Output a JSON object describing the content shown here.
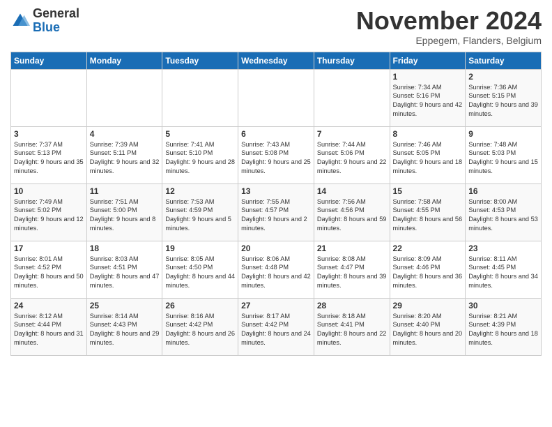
{
  "logo": {
    "general": "General",
    "blue": "Blue"
  },
  "title": "November 2024",
  "subtitle": "Eppegem, Flanders, Belgium",
  "weekdays": [
    "Sunday",
    "Monday",
    "Tuesday",
    "Wednesday",
    "Thursday",
    "Friday",
    "Saturday"
  ],
  "weeks": [
    [
      {
        "day": "",
        "info": ""
      },
      {
        "day": "",
        "info": ""
      },
      {
        "day": "",
        "info": ""
      },
      {
        "day": "",
        "info": ""
      },
      {
        "day": "",
        "info": ""
      },
      {
        "day": "1",
        "info": "Sunrise: 7:34 AM\nSunset: 5:16 PM\nDaylight: 9 hours and 42 minutes."
      },
      {
        "day": "2",
        "info": "Sunrise: 7:36 AM\nSunset: 5:15 PM\nDaylight: 9 hours and 39 minutes."
      }
    ],
    [
      {
        "day": "3",
        "info": "Sunrise: 7:37 AM\nSunset: 5:13 PM\nDaylight: 9 hours and 35 minutes."
      },
      {
        "day": "4",
        "info": "Sunrise: 7:39 AM\nSunset: 5:11 PM\nDaylight: 9 hours and 32 minutes."
      },
      {
        "day": "5",
        "info": "Sunrise: 7:41 AM\nSunset: 5:10 PM\nDaylight: 9 hours and 28 minutes."
      },
      {
        "day": "6",
        "info": "Sunrise: 7:43 AM\nSunset: 5:08 PM\nDaylight: 9 hours and 25 minutes."
      },
      {
        "day": "7",
        "info": "Sunrise: 7:44 AM\nSunset: 5:06 PM\nDaylight: 9 hours and 22 minutes."
      },
      {
        "day": "8",
        "info": "Sunrise: 7:46 AM\nSunset: 5:05 PM\nDaylight: 9 hours and 18 minutes."
      },
      {
        "day": "9",
        "info": "Sunrise: 7:48 AM\nSunset: 5:03 PM\nDaylight: 9 hours and 15 minutes."
      }
    ],
    [
      {
        "day": "10",
        "info": "Sunrise: 7:49 AM\nSunset: 5:02 PM\nDaylight: 9 hours and 12 minutes."
      },
      {
        "day": "11",
        "info": "Sunrise: 7:51 AM\nSunset: 5:00 PM\nDaylight: 9 hours and 8 minutes."
      },
      {
        "day": "12",
        "info": "Sunrise: 7:53 AM\nSunset: 4:59 PM\nDaylight: 9 hours and 5 minutes."
      },
      {
        "day": "13",
        "info": "Sunrise: 7:55 AM\nSunset: 4:57 PM\nDaylight: 9 hours and 2 minutes."
      },
      {
        "day": "14",
        "info": "Sunrise: 7:56 AM\nSunset: 4:56 PM\nDaylight: 8 hours and 59 minutes."
      },
      {
        "day": "15",
        "info": "Sunrise: 7:58 AM\nSunset: 4:55 PM\nDaylight: 8 hours and 56 minutes."
      },
      {
        "day": "16",
        "info": "Sunrise: 8:00 AM\nSunset: 4:53 PM\nDaylight: 8 hours and 53 minutes."
      }
    ],
    [
      {
        "day": "17",
        "info": "Sunrise: 8:01 AM\nSunset: 4:52 PM\nDaylight: 8 hours and 50 minutes."
      },
      {
        "day": "18",
        "info": "Sunrise: 8:03 AM\nSunset: 4:51 PM\nDaylight: 8 hours and 47 minutes."
      },
      {
        "day": "19",
        "info": "Sunrise: 8:05 AM\nSunset: 4:50 PM\nDaylight: 8 hours and 44 minutes."
      },
      {
        "day": "20",
        "info": "Sunrise: 8:06 AM\nSunset: 4:48 PM\nDaylight: 8 hours and 42 minutes."
      },
      {
        "day": "21",
        "info": "Sunrise: 8:08 AM\nSunset: 4:47 PM\nDaylight: 8 hours and 39 minutes."
      },
      {
        "day": "22",
        "info": "Sunrise: 8:09 AM\nSunset: 4:46 PM\nDaylight: 8 hours and 36 minutes."
      },
      {
        "day": "23",
        "info": "Sunrise: 8:11 AM\nSunset: 4:45 PM\nDaylight: 8 hours and 34 minutes."
      }
    ],
    [
      {
        "day": "24",
        "info": "Sunrise: 8:12 AM\nSunset: 4:44 PM\nDaylight: 8 hours and 31 minutes."
      },
      {
        "day": "25",
        "info": "Sunrise: 8:14 AM\nSunset: 4:43 PM\nDaylight: 8 hours and 29 minutes."
      },
      {
        "day": "26",
        "info": "Sunrise: 8:16 AM\nSunset: 4:42 PM\nDaylight: 8 hours and 26 minutes."
      },
      {
        "day": "27",
        "info": "Sunrise: 8:17 AM\nSunset: 4:42 PM\nDaylight: 8 hours and 24 minutes."
      },
      {
        "day": "28",
        "info": "Sunrise: 8:18 AM\nSunset: 4:41 PM\nDaylight: 8 hours and 22 minutes."
      },
      {
        "day": "29",
        "info": "Sunrise: 8:20 AM\nSunset: 4:40 PM\nDaylight: 8 hours and 20 minutes."
      },
      {
        "day": "30",
        "info": "Sunrise: 8:21 AM\nSunset: 4:39 PM\nDaylight: 8 hours and 18 minutes."
      }
    ]
  ]
}
